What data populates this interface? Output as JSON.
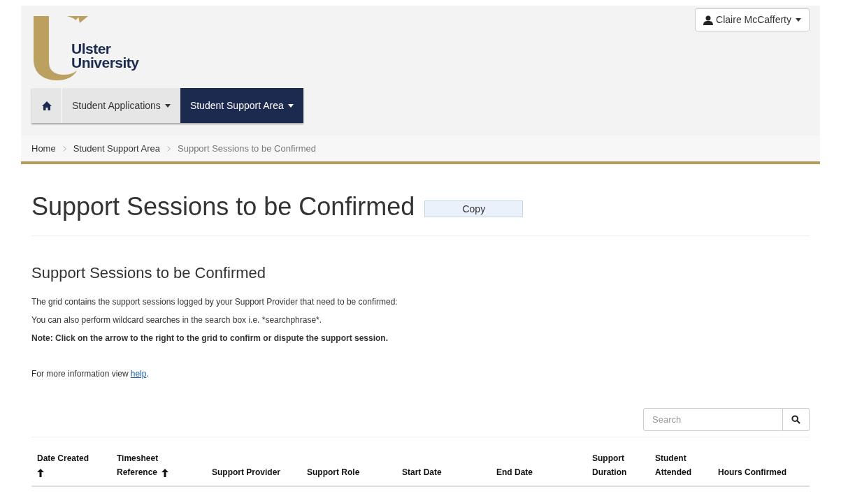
{
  "logo": {
    "lines": [
      "Ulster",
      "University"
    ]
  },
  "user_menu": {
    "label": "Claire McCafferty"
  },
  "nav": [
    {
      "kind": "home",
      "selected": false
    },
    {
      "kind": "menu",
      "label": "Student Applications",
      "selected": false
    },
    {
      "kind": "menu",
      "label": "Student Support Area",
      "selected": true
    }
  ],
  "breadcrumb": [
    {
      "label": "Home",
      "current": false
    },
    {
      "label": "Student Support Area",
      "current": false
    },
    {
      "label": "Support Sessions to be Confirmed",
      "current": true
    }
  ],
  "page_title": "Support Sessions to be Confirmed",
  "copy_button": "Copy",
  "section_title": "Support Sessions to be Confirmed",
  "paragraphs": [
    "The grid contains the support sessions logged by your Support Provider that need to be confirmed:",
    "You can also perform wildcard searches in the search box i.e. *searchphrase*."
  ],
  "note": "Note: Click on the arrow to the right to the grid to confirm or dispute the support session.",
  "help": {
    "text": "For more information view ",
    "link": "help",
    "after": "."
  },
  "search": {
    "placeholder": "Search"
  },
  "table": {
    "columns": [
      {
        "lines": [
          "Date Created"
        ],
        "sorted": true
      },
      {
        "lines": [
          "Timesheet",
          "Reference"
        ],
        "sorted": true
      },
      {
        "lines": [
          "Support Provider"
        ],
        "sorted": false
      },
      {
        "lines": [
          "Support Role"
        ],
        "sorted": false
      },
      {
        "lines": [
          "Start Date"
        ],
        "sorted": false
      },
      {
        "lines": [
          "End Date"
        ],
        "sorted": false
      },
      {
        "lines": [
          "Support",
          "Duration"
        ],
        "sorted": false
      },
      {
        "lines": [
          "Student",
          "Attended"
        ],
        "sorted": false
      },
      {
        "lines": [
          "Hours Confirmed"
        ],
        "sorted": false
      }
    ]
  }
}
